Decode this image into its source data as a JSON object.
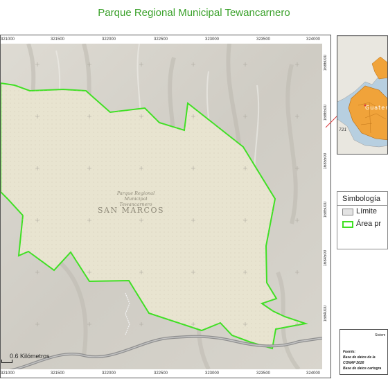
{
  "title": "Parque Regional Municipal Tewancarnero",
  "map": {
    "x_ticks": [
      "321000",
      "321500",
      "322000",
      "322500",
      "323000",
      "323500",
      "324000"
    ],
    "y_ticks": [
      "1686000",
      "1686500",
      "1685500",
      "1685000",
      "1684500",
      "1684000"
    ],
    "region_label": "SAN MARCOS",
    "park_label": "Parque Regional Municipal Tewancarnero",
    "scale_label": "0.6 Kilómetros"
  },
  "locator": {
    "label": "Guatemala",
    "route_label": "721"
  },
  "legend": {
    "title": "Simbología",
    "items": [
      {
        "label": "Límite",
        "color": "#e3e3e3"
      },
      {
        "label": "Área pr",
        "color": "#3fe023"
      }
    ]
  },
  "info": {
    "title": "Sistem",
    "source_label": "Fuente:",
    "lines": [
      "Base de datos de la",
      "CONAP 2026",
      "Base de datos cartogra"
    ]
  },
  "colors": {
    "title": "#3aa12a",
    "park_boundary": "#3fe023",
    "terrain": "#d9d7d0",
    "park_fill": "#e8e4d0",
    "locator_land": "#f0a33a",
    "locator_sea": "#b7cfe0"
  }
}
